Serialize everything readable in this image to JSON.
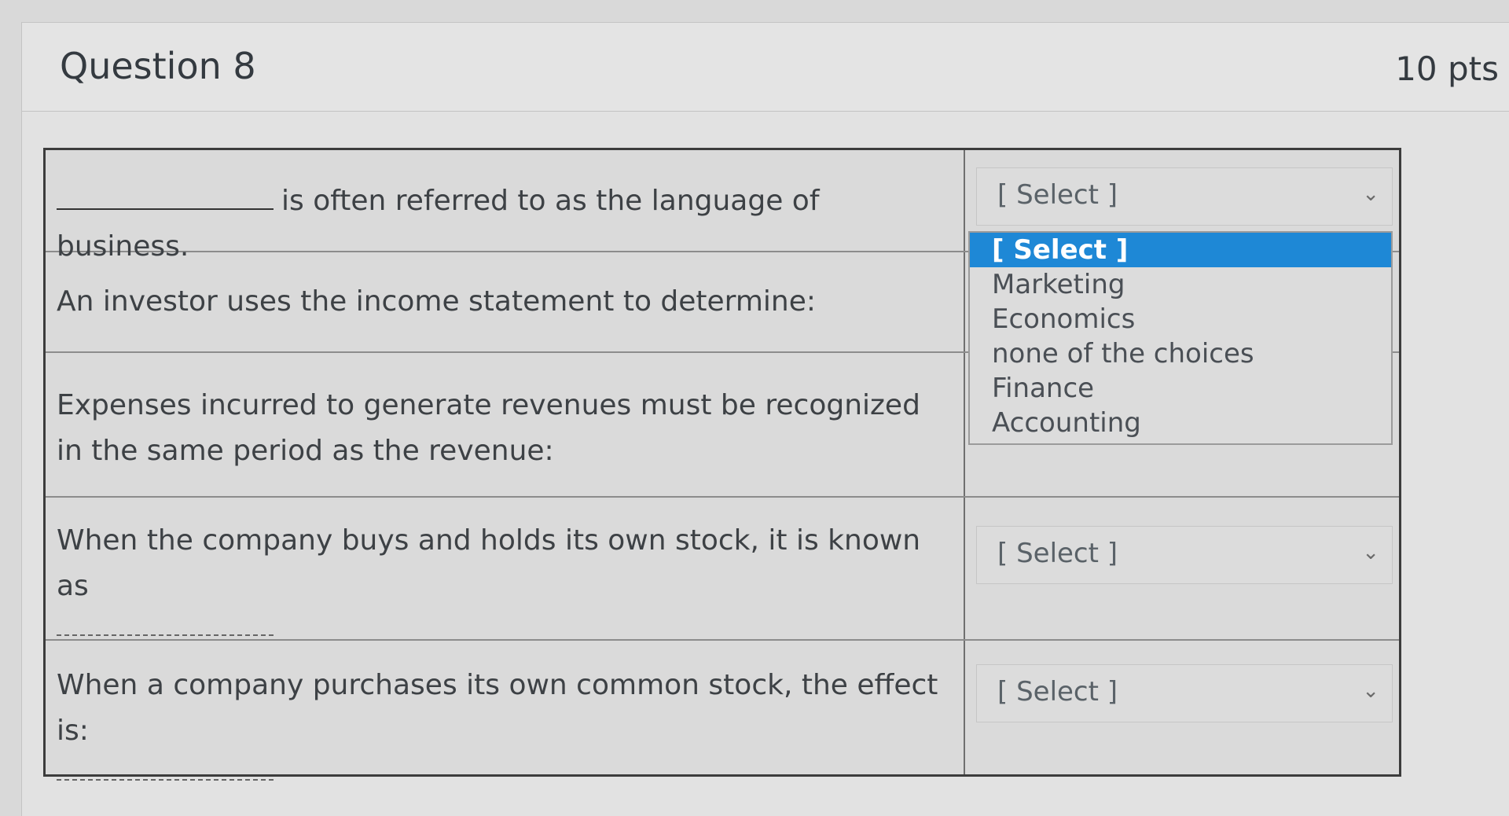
{
  "question": {
    "title": "Question 8",
    "points": "10 pts"
  },
  "rows": [
    {
      "prompt": "is often referred to as the language of business.",
      "select_value": "[ Select ]",
      "dropdown_open": true
    },
    {
      "prompt": "An investor uses the income statement to determine:",
      "select_value": "[ Select ]",
      "dropdown_open": false
    },
    {
      "prompt": "Expenses incurred to generate revenues must be recognized in the same period as the revenue:",
      "select_value": "[ Select ]",
      "dropdown_open": false
    },
    {
      "prompt": "When the company buys and holds its own stock, it is known as",
      "blank_suffix": ".",
      "select_value": "[ Select ]",
      "dropdown_open": false
    },
    {
      "prompt": "When a company purchases its own common stock, the effect is:",
      "select_value": "[ Select ]",
      "dropdown_open": false
    }
  ],
  "dropdown": {
    "options": [
      "[ Select ]",
      "Marketing",
      "Economics",
      "none of the choices",
      "Finance",
      "Accounting"
    ],
    "highlighted_index": 0
  },
  "colors": {
    "highlight": "#1e88d6",
    "background": "#d9d9d9"
  }
}
